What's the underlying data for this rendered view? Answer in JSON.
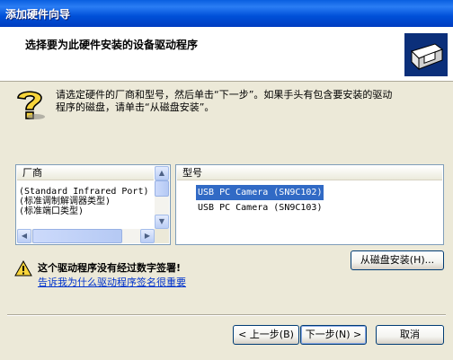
{
  "window": {
    "title": "添加硬件向导"
  },
  "header": {
    "title": "选择要为此硬件安装的设备驱动程序"
  },
  "instructions": {
    "line1": "请选定硬件的厂商和型号，然后单击“下一步”。如果手头有包含要安装的驱动",
    "line2": "程序的磁盘，请单击“从磁盘安装”。"
  },
  "manufacturers": {
    "header": "厂商",
    "items": [
      "(Standard Infrared Port)",
      "(标准调制解调器类型)",
      "(标准端口类型)"
    ]
  },
  "models": {
    "header": "型号",
    "items": [
      "USB PC Camera (SN9C102)",
      "USB PC Camera (SN9C103)"
    ],
    "selected_index": 0
  },
  "warning": {
    "text": "这个驱动程序没有经过数字签署!",
    "link": "告诉我为什么驱动程序签名很重要"
  },
  "buttons": {
    "have_disk": "从磁盘安装(H)...",
    "back": "< 上一步(B)",
    "next": "下一步(N) >",
    "cancel": "取消"
  },
  "colors": {
    "accent": "#316AC5",
    "title_bar": "#0A5FE0",
    "link": "#0033CC"
  },
  "icons": [
    "hardware-icon",
    "question-icon",
    "warning-icon",
    "scroll-up-icon",
    "scroll-down-icon",
    "scroll-left-icon",
    "scroll-right-icon"
  ]
}
